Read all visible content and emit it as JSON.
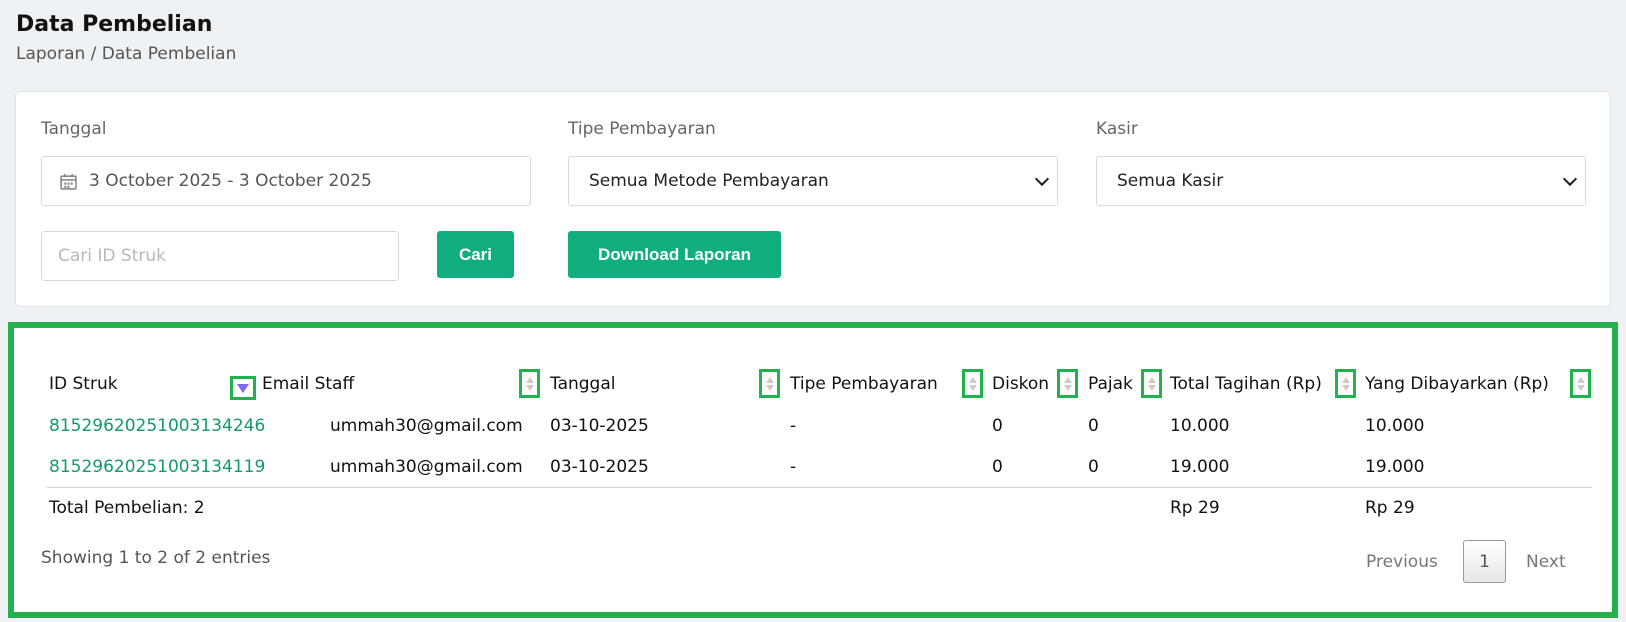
{
  "header": {
    "title": "Data Pembelian",
    "breadcrumb": "Laporan / Data Pembelian"
  },
  "filters": {
    "date_label": "Tanggal",
    "date_value": "3 October 2025 - 3 October 2025",
    "payment_label": "Tipe Pembayaran",
    "payment_value": "Semua Metode Pembayaran",
    "cashier_label": "Kasir",
    "cashier_value": "Semua Kasir",
    "search_placeholder": "Cari ID Struk",
    "search_button": "Cari",
    "download_button": "Download Laporan"
  },
  "table": {
    "headers": [
      "ID Struk",
      "Email Staff",
      "Tanggal",
      "Tipe Pembayaran",
      "Diskon",
      "Pajak",
      "Total Tagihan (Rp)",
      "Yang Dibayarkan (Rp)"
    ],
    "rows": [
      [
        "81529620251003134246",
        "ummah30@gmail.com",
        "03-10-2025",
        "-",
        "0",
        "0",
        "10.000",
        "10.000"
      ],
      [
        "81529620251003134119",
        "ummah30@gmail.com",
        "03-10-2025",
        "-",
        "0",
        "0",
        "19.000",
        "19.000"
      ]
    ],
    "footer": {
      "label": "Total Pembelian: 2",
      "total_tagihan": "Rp 29",
      "total_dibayar": "Rp 29"
    },
    "info": "Showing 1 to 2 of 2 entries",
    "pagination": {
      "previous": "Previous",
      "current": "1",
      "next": "Next"
    }
  },
  "colors": {
    "accent": "#10ae7f",
    "highlight": "#22b14c",
    "link": "#14996b"
  }
}
